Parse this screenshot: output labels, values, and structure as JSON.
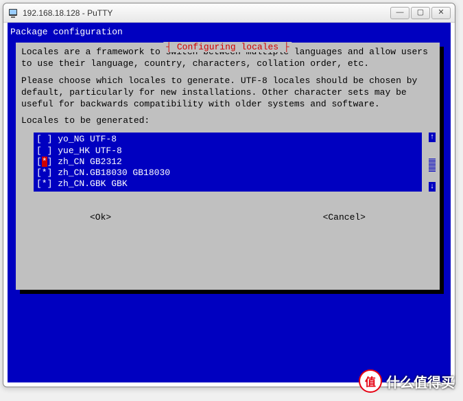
{
  "window": {
    "title": "192.168.18.128 - PuTTY",
    "buttons": {
      "min": "—",
      "max": "▢",
      "close": "✕"
    }
  },
  "terminal": {
    "header": "Package configuration"
  },
  "dialog": {
    "title": "┤ Configuring locales ├",
    "paragraph1": "Locales are a framework to switch between multiple languages and allow users to use their language, country, characters, collation order, etc.",
    "paragraph2": "Please choose which locales to generate. UTF-8 locales should be chosen by default, particularly for new installations. Other character sets may be useful for backwards compatibility with older systems and software.",
    "prompt": "Locales to be generated:",
    "items": [
      {
        "checked": false,
        "label": "yo_NG UTF-8",
        "cursor": false
      },
      {
        "checked": false,
        "label": "yue_HK UTF-8",
        "cursor": false
      },
      {
        "checked": true,
        "label": "zh_CN GB2312",
        "cursor": true
      },
      {
        "checked": true,
        "label": "zh_CN.GB18030 GB18030",
        "cursor": false
      },
      {
        "checked": true,
        "label": "zh_CN.GBK GBK",
        "cursor": false
      }
    ],
    "ok": "<Ok>",
    "cancel": "<Cancel>",
    "scroll": {
      "up": "↑",
      "down": "↓",
      "thumb_top_pct": 40,
      "thumb_height_pct": 35
    }
  },
  "watermark": {
    "badge": "值",
    "text": "什么值得买"
  }
}
